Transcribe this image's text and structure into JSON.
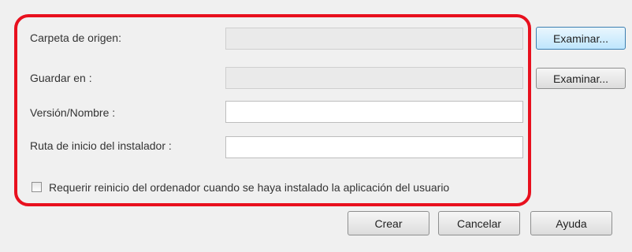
{
  "form": {
    "source_folder": {
      "label": "Carpeta de origen:",
      "value": ""
    },
    "save_to": {
      "label": "Guardar en :",
      "value": ""
    },
    "version_name": {
      "label": "Versión/Nombre :",
      "value": ""
    },
    "installer_path": {
      "label": "Ruta de inicio del instalador :",
      "value": ""
    },
    "browse_label": "Examinar...",
    "restart_checkbox": {
      "label": "Requerir reinicio del ordenador cuando se haya instalado la aplicación del usuario",
      "checked": false
    }
  },
  "footer": {
    "create_label": "Crear",
    "cancel_label": "Cancelar",
    "help_label": "Ayuda"
  },
  "colors": {
    "highlight": "#e8101e",
    "background": "#f0f0f0"
  }
}
